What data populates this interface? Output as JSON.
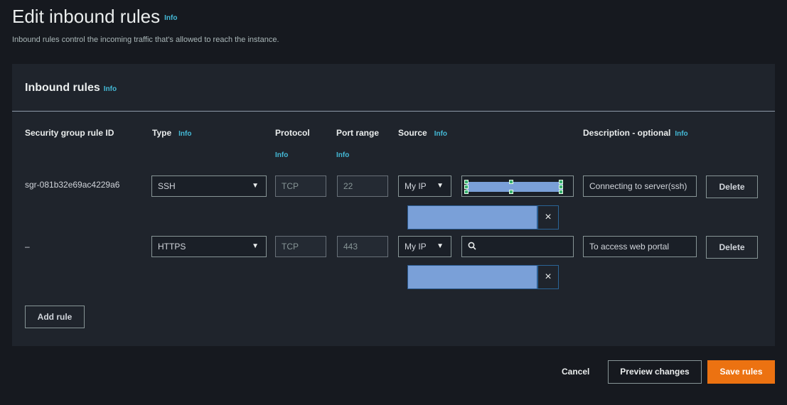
{
  "page": {
    "title": "Edit inbound rules",
    "title_info": "Info",
    "subtitle": "Inbound rules control the incoming traffic that's allowed to reach the instance."
  },
  "panel": {
    "title": "Inbound rules",
    "title_info": "Info"
  },
  "columns": {
    "rule_id": "Security group rule ID",
    "type": "Type",
    "type_info": "Info",
    "protocol": "Protocol",
    "protocol_info": "Info",
    "port_range": "Port range",
    "port_info": "Info",
    "source": "Source",
    "source_info": "Info",
    "description": "Description - optional",
    "description_info": "Info"
  },
  "rules": [
    {
      "id": "sgr-081b32e69ac4229a6",
      "type": "SSH",
      "protocol": "TCP",
      "port": "22",
      "source": "My IP",
      "description": "Connecting to server(ssh)",
      "delete_label": "Delete"
    },
    {
      "id": "–",
      "type": "HTTPS",
      "protocol": "TCP",
      "port": "443",
      "source": "My IP",
      "description": "To access web portal",
      "delete_label": "Delete"
    }
  ],
  "add_rule_label": "Add rule",
  "footer": {
    "cancel": "Cancel",
    "preview": "Preview changes",
    "save": "Save rules"
  },
  "icons": {
    "dropdown": "caret-down-icon",
    "remove": "close-icon",
    "search": "search-icon"
  },
  "colors": {
    "accent": "#ec7211",
    "info_link": "#44b9d6",
    "background": "#16191f"
  }
}
